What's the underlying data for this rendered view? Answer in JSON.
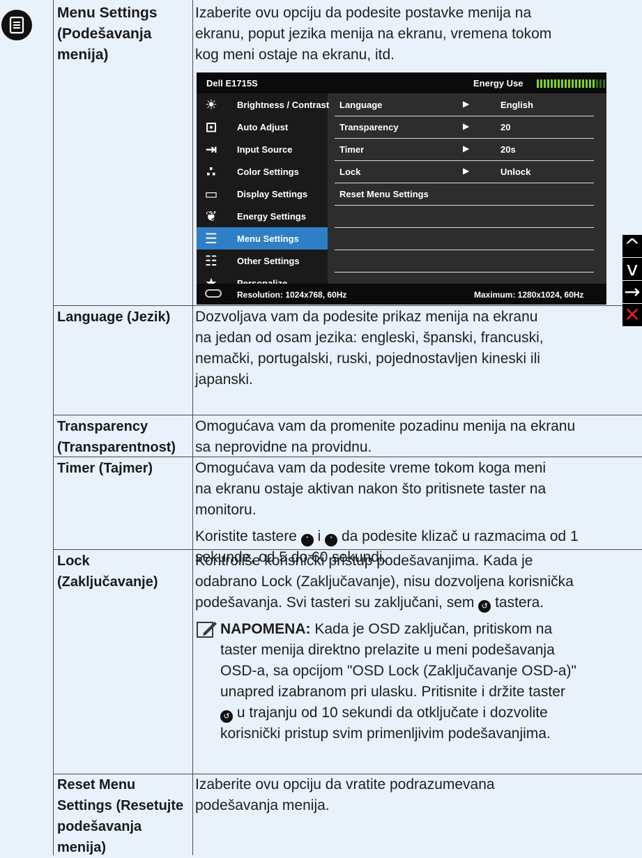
{
  "header": {
    "icon": "menu-icon",
    "label": "Menu Settings (Podešavanja menija)",
    "label_lines": [
      "Menu Settings",
      "(Podešavanja",
      "menija)"
    ],
    "description_lines": [
      "Izaberite ovu opciju da podesite postavke menija na",
      "ekranu, poput jezika menija na ekranu, vremena tokom",
      "kog meni ostaje na ekranu, itd."
    ]
  },
  "osd": {
    "model": "Dell E1715S",
    "energy_label": "Energy Use",
    "energy_level": 0.85,
    "menu_items": [
      {
        "icon": "brightness-icon",
        "label": "Brightness / Contrast"
      },
      {
        "icon": "auto-adjust-icon",
        "label": "Auto Adjust"
      },
      {
        "icon": "input-source-icon",
        "label": "Input Source"
      },
      {
        "icon": "color-settings-icon",
        "label": "Color Settings"
      },
      {
        "icon": "display-settings-icon",
        "label": "Display Settings"
      },
      {
        "icon": "energy-settings-icon",
        "label": "Energy Settings"
      },
      {
        "icon": "menu-settings-icon",
        "label": "Menu Settings",
        "selected": true
      },
      {
        "icon": "other-settings-icon",
        "label": "Other Settings"
      },
      {
        "icon": "personalize-icon",
        "label": "Personalize"
      }
    ],
    "options": [
      {
        "key": "Language",
        "value": "English"
      },
      {
        "key": "Transparency",
        "value": "20"
      },
      {
        "key": "Timer",
        "value": "20s"
      },
      {
        "key": "Lock",
        "value": "Unlock"
      },
      {
        "key": "Reset Menu Settings",
        "value": ""
      }
    ],
    "resolution": "Resolution: 1024x768, 60Hz",
    "maximum": "Maximum: 1280x1024, 60Hz",
    "side_controls": [
      {
        "icon": "up-arrow-icon",
        "glyph": "^",
        "color": "#ffffff"
      },
      {
        "icon": "down-arrow-icon",
        "glyph": "v",
        "color": "#ffffff"
      },
      {
        "icon": "right-arrow-icon",
        "glyph": "→",
        "color": "#ffffff"
      },
      {
        "icon": "close-icon",
        "glyph": "✕",
        "color": "#e02020"
      }
    ]
  },
  "rows": {
    "language": {
      "label": "Language (Jezik)",
      "lines": [
        "Dozvoljava vam da podesite prikaz menija na ekranu",
        "na jedan od osam jezika: engleski, španski, francuski,",
        "nemački, portugalski, ruski, pojednostavljen kineski ili",
        "japanski."
      ]
    },
    "transparency": {
      "label_lines": [
        "Transparency",
        "(Transparentnost)"
      ],
      "lines": [
        "Omogućava vam da promenite pozadinu menija na ekranu",
        "sa neprovidne na providnu."
      ]
    },
    "timer": {
      "label": "Timer (Tajmer)",
      "lines": [
        "Omogućava vam da podesite vreme tokom koga meni",
        "na ekranu ostaje aktivan nakon što pritisnete taster na",
        "monitoru."
      ],
      "slider_pre": "Koristite tastere",
      "slider_mid": "i",
      "slider_post": "da podesite klizač u razmacima od 1",
      "slider_line2": "sekunde, od 5 do 60 sekundi."
    },
    "lock": {
      "label_lines": [
        "Lock",
        "(Zaključavanje)"
      ],
      "lines": [
        "Kontroliše korisnički pristup podešavanjima. Kada je",
        "odabrano Lock (Zaključavanje), nisu dozvoljena korisnička"
      ],
      "line3_pre": "podešavanja. Svi tasteri su zaključani, sem",
      "line3_post": "tastera.",
      "note_label": "NAPOMENA:",
      "note_first": "Kada je OSD zaključan, pritiskom na",
      "note_lines": [
        "taster menija direktno prelazite u meni podešavanja",
        "OSD-a, sa opcijom \"OSD Lock (Zaključavanje OSD-a)\"",
        "unapred izabranom pri ulasku. Pritisnite i držite taster"
      ],
      "note_line5": "u trajanju od 10 sekundi da otključate i dozvolite",
      "note_line6": "korisnički pristup svim primenljivim podešavanjima."
    },
    "reset": {
      "label_lines": [
        "Reset Menu",
        "Settings (Resetujte",
        "podešavanja",
        "menija)"
      ],
      "lines": [
        "Izaberite ovu opciju da vratite podrazumevana",
        "podešavanja menija."
      ]
    }
  }
}
